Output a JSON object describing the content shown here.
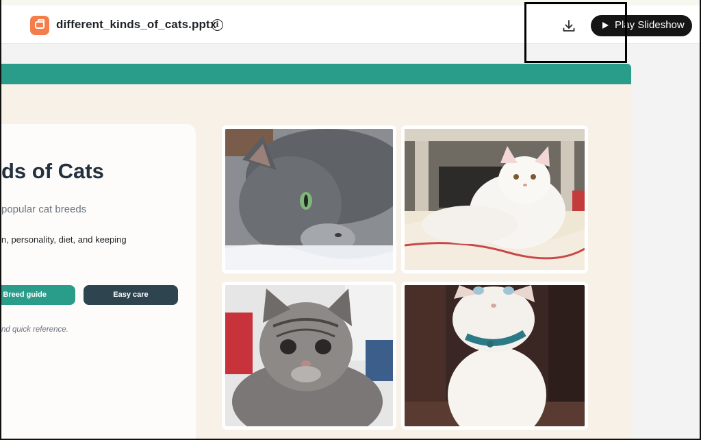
{
  "header": {
    "file_name": "different_kinds_of_cats.pptx",
    "info_icon": "info-icon",
    "download_icon": "download-icon",
    "play_label": "Play Slideshow"
  },
  "slide": {
    "accent_color": "#2a9c8a",
    "title": "ds of Cats",
    "subtitle": "popular cat breeds",
    "description": "n, personality, diet, and keeping",
    "buttons": {
      "breed_guide": "Breed guide",
      "easy_care": "Easy care"
    },
    "note": "nd quick reference.",
    "photos": [
      {
        "name": "gray-cat-photo"
      },
      {
        "name": "white-persian-cat-photo"
      },
      {
        "name": "tabby-kitten-photo"
      },
      {
        "name": "white-kitten-with-collar-photo"
      }
    ]
  }
}
